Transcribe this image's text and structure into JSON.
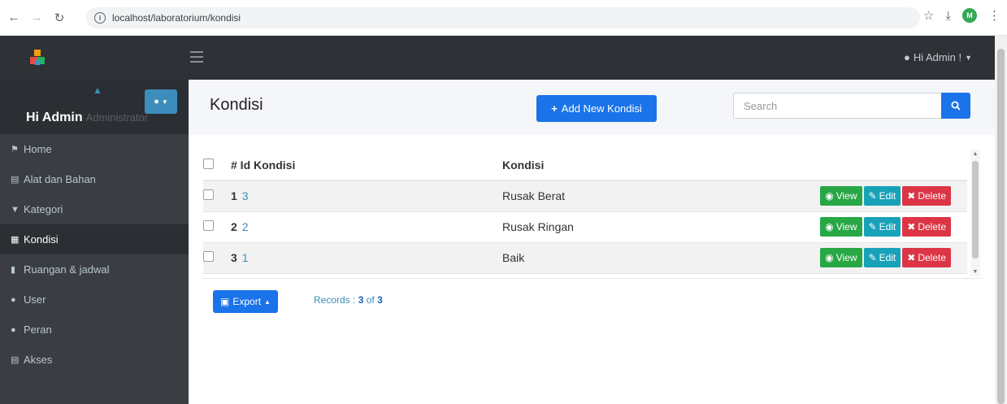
{
  "browser": {
    "url": "localhost/laboratorium/kondisi",
    "profile_initial": "M"
  },
  "topbar": {
    "greeting": "Hi Admin !"
  },
  "sidebar": {
    "user_name": "Hi Admin",
    "user_role": "Administrator",
    "items": [
      {
        "label": "Home",
        "icon": "home-icon"
      },
      {
        "label": "Alat dan Bahan",
        "icon": "database-icon"
      },
      {
        "label": "Kategori",
        "icon": "filter-icon"
      },
      {
        "label": "Kondisi",
        "icon": "calculator-icon",
        "active": true
      },
      {
        "label": "Ruangan & jadwal",
        "icon": "file-icon"
      },
      {
        "label": "User",
        "icon": "user-icon"
      },
      {
        "label": "Peran",
        "icon": "users-icon"
      },
      {
        "label": "Akses",
        "icon": "database-icon"
      }
    ]
  },
  "main": {
    "title": "Kondisi",
    "add_button": "Add New Kondisi",
    "search_placeholder": "Search",
    "table": {
      "headers": [
        "# Id Kondisi",
        "Kondisi"
      ],
      "rows": [
        {
          "num": "1",
          "id": "3",
          "kondisi": "Rusak Berat"
        },
        {
          "num": "2",
          "id": "2",
          "kondisi": "Rusak Ringan"
        },
        {
          "num": "3",
          "id": "1",
          "kondisi": "Baik"
        }
      ],
      "actions": {
        "view": "View",
        "edit": "Edit",
        "delete": "Delete"
      }
    },
    "export_button": "Export",
    "records_label": "Records :",
    "records_shown": "3",
    "records_of": "of",
    "records_total": "3"
  },
  "colors": {
    "primary": "#1a73e8",
    "view": "#28a745",
    "edit": "#17a2b8",
    "delete": "#dc3545",
    "sidebar": "#3a3d42"
  }
}
